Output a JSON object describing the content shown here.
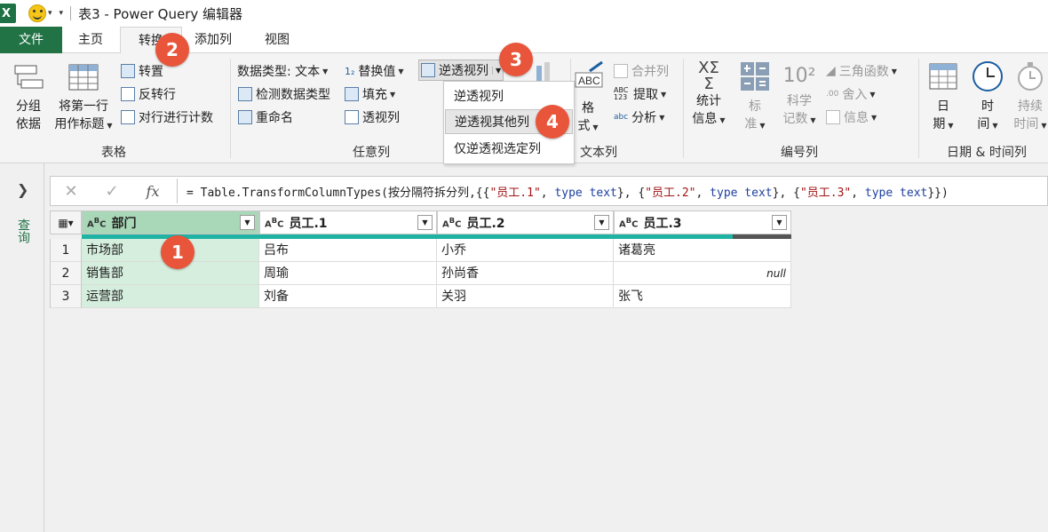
{
  "titlebar": {
    "app_icon": "X",
    "window_title": "表3 - Power Query 编辑器"
  },
  "tabs": {
    "file": "文件",
    "home": "主页",
    "transform": "转换",
    "add_column": "添加列",
    "view": "视图"
  },
  "ribbon": {
    "table_group": {
      "group_by": [
        "分组",
        "依据"
      ],
      "use_first_row": [
        "将第一行",
        "用作标题"
      ],
      "transpose": "转置",
      "reverse_rows": "反转行",
      "count_rows": "对行进行计数",
      "label": "表格"
    },
    "any_column_group": {
      "data_type": "数据类型: 文本",
      "detect_type": "检测数据类型",
      "rename": "重命名",
      "replace_values": "替换值",
      "fill": "填充",
      "pivot_column": "透视列",
      "unpivot": "逆透视列",
      "label": "任意列"
    },
    "text_column_group": {
      "format": [
        "格",
        "式"
      ],
      "merge_columns": "合并列",
      "extract": "提取",
      "parse": "分析",
      "label": "文本列"
    },
    "number_column_group": {
      "statistics": [
        "统计",
        "信息"
      ],
      "standard": [
        "标",
        "准"
      ],
      "scientific": [
        "科学",
        "记数"
      ],
      "trigonometry": "三角函数",
      "rounding": "舍入",
      "information": "信息",
      "label": "编号列"
    },
    "datetime_group": {
      "date": [
        "日",
        "期"
      ],
      "time": [
        "时",
        "间"
      ],
      "duration": [
        "持续",
        "时间"
      ],
      "label": "日期 & 时间列"
    },
    "unpivot_menu": [
      "逆透视列",
      "逆透视其他列",
      "仅逆透视选定列"
    ]
  },
  "badges": [
    "1",
    "2",
    "3",
    "4"
  ],
  "left_panel": {
    "label": "查询"
  },
  "formula_bar": {
    "cancel": "✕",
    "confirm": "✓",
    "fx": "fx",
    "prefix": "= Table.TransformColumnTypes(按分隔符拆分列,{{",
    "s1": "\"员工.1\"",
    "t1": "type text",
    "mid1": "}, {",
    "s2": "\"员工.2\"",
    "t2": "type text",
    "mid2": "}, {",
    "s3": "\"员工.3\"",
    "t3": "type text",
    "suffix": "}})"
  },
  "grid": {
    "columns": [
      "部门",
      "员工.1",
      "员工.2",
      "员工.3"
    ],
    "rows": [
      {
        "n": "1",
        "cells": [
          "市场部",
          "吕布",
          "小乔",
          "诸葛亮"
        ]
      },
      {
        "n": "2",
        "cells": [
          "销售部",
          "周瑜",
          "孙尚香",
          "null"
        ]
      },
      {
        "n": "3",
        "cells": [
          "运营部",
          "刘备",
          "关羽",
          "张飞"
        ]
      }
    ]
  },
  "colors": {
    "excel_green": "#217346",
    "badge": "#e8553a",
    "quality_bar": "#1fb3a4",
    "selected_col": "#d5eedd"
  }
}
